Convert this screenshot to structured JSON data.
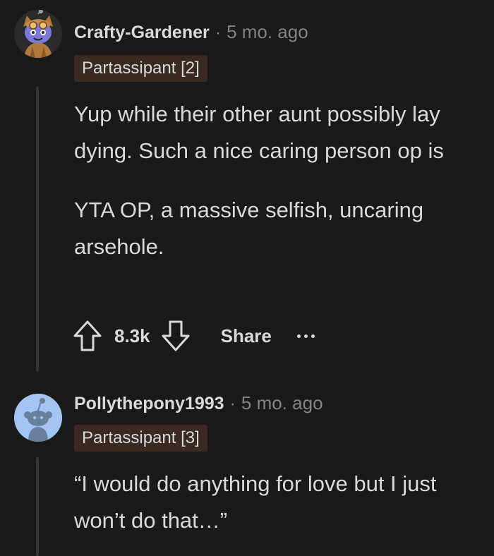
{
  "comments": [
    {
      "username": "Crafty-Gardener",
      "separator": "·",
      "age": "5 mo. ago",
      "flair": "Partassipant [2]",
      "paragraphs": [
        "Yup while their other aunt possibly lay dying. Such a nice caring person op is",
        "YTA OP, a massive selfish, uncaring arsehole."
      ],
      "score": "8.3k",
      "share_label": "Share"
    },
    {
      "username": "Pollythepony1993",
      "separator": "·",
      "age": "5 mo. ago",
      "flair": "Partassipant [3]",
      "paragraphs": [
        "“I would do anything for love but I just won’t do that…”"
      ]
    }
  ],
  "colors": {
    "background": "#1a1a1b",
    "text": "#d7dadc",
    "muted": "#818384",
    "flair_bg": "#3a2a22",
    "thread_line": "#343536",
    "avatar2_bg": "#a3c3f0"
  }
}
